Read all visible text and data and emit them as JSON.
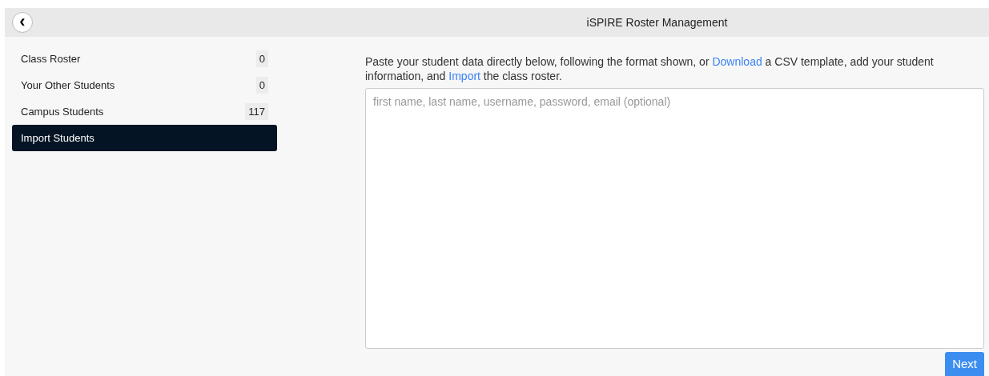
{
  "header": {
    "back_icon": "‹",
    "title": "iSPIRE Roster Management"
  },
  "sidebar": {
    "items": [
      {
        "label": "Class Roster",
        "count": "0",
        "selected": false
      },
      {
        "label": "Your Other Students",
        "count": "0",
        "selected": false
      },
      {
        "label": "Campus Students",
        "count": "117",
        "selected": false
      },
      {
        "label": "Import Students",
        "selected": true
      }
    ]
  },
  "instructions": [
    {
      "kind": "text",
      "text": "Paste your student data directly below, following the format shown, or "
    },
    {
      "kind": "link",
      "text": "Download"
    },
    {
      "kind": "text",
      "text": " a CSV template, add your student information, and "
    },
    {
      "kind": "link",
      "text": "Import"
    },
    {
      "kind": "text",
      "text": " the class roster."
    }
  ],
  "data_field": {
    "placeholder": "first name, last name, username, password, email (optional)"
  },
  "next_button": "Next"
}
